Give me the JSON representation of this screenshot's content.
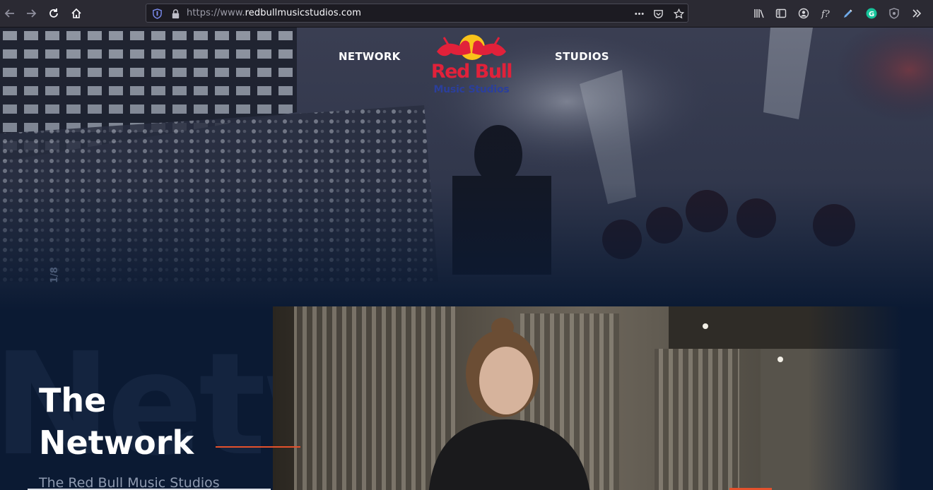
{
  "browser": {
    "url_prefix": "https://www.",
    "url_domain": "redbullmusicstudios.com",
    "icons": [
      "back-arrow-icon",
      "forward-arrow-icon",
      "reload-icon",
      "home-icon",
      "shield-icon",
      "lock-icon",
      "more-dots-icon",
      "pocket-icon",
      "star-icon",
      "library-icon",
      "sidebar-icon",
      "account-icon",
      "font-extension-icon",
      "pen-extension-icon",
      "grammarly-icon",
      "privacy-badger-icon",
      "overflow-chevron-icon"
    ],
    "extension_badge": "G"
  },
  "nav": {
    "left_link": "NETWORK",
    "right_link": "STUDIOS"
  },
  "logo": {
    "line1": "Red Bull",
    "line2": "Music Studios",
    "colors": {
      "red": "#e1213a",
      "blue": "#2b3f9b",
      "yellow": "#f9c21a"
    }
  },
  "slider": {
    "counter": "1/8"
  },
  "section": {
    "background_word": "Netw",
    "title_line1": "The",
    "title_line2": "Network",
    "subtitle": "The Red Bull Music Studios"
  },
  "colors": {
    "page_bg": "#0b1a33",
    "accent": "#e4512c"
  }
}
